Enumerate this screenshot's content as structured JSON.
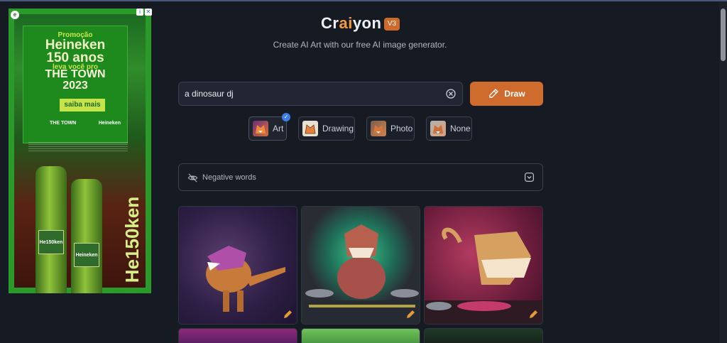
{
  "ad": {
    "line1": "Promoção",
    "line2": "Heineken",
    "line3": "150 anos",
    "line4": "leva você pro",
    "line5": "THE TOWN",
    "line6": "2023",
    "cta": "saiba mais",
    "logo_left": "THE TOWN",
    "logo_right": "Heineken",
    "side_text": "He150ken",
    "bottle_label": "He150ken",
    "badge": "e",
    "info_icon": "info-icon",
    "close_icon": "close-icon"
  },
  "header": {
    "logo_pre": "Cr",
    "logo_accent": "ai",
    "logo_post": "yon",
    "version": "V3",
    "subtitle": "Create AI Art with our free AI image generator."
  },
  "prompt": {
    "value": "a dinosaur dj",
    "clear_icon": "clear-circle-icon"
  },
  "draw_button": {
    "label": "Draw",
    "icon": "brush-icon"
  },
  "styles": [
    {
      "label": "Art",
      "selected": true
    },
    {
      "label": "Drawing",
      "selected": false
    },
    {
      "label": "Photo",
      "selected": false
    },
    {
      "label": "None",
      "selected": false
    }
  ],
  "negative": {
    "label": "Negative words",
    "icon": "eye-off-icon",
    "chevron": "chevron-down-icon"
  },
  "colors": {
    "accent": "#cf6b2c",
    "background": "#161a23",
    "selected_check": "#3c7ee8"
  }
}
